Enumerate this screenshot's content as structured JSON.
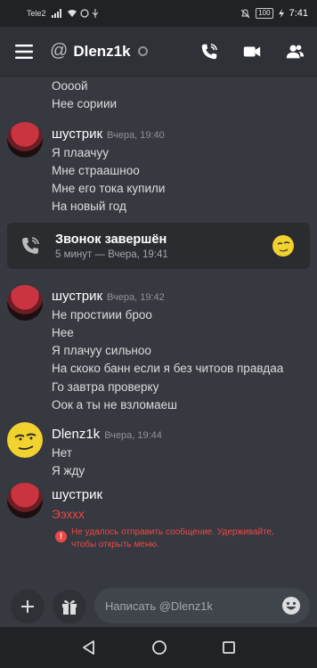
{
  "status_bar": {
    "carrier": "Tele2",
    "battery": "100",
    "time": "7:41"
  },
  "header": {
    "at_symbol": "@",
    "channel_name": "Dlenz1k"
  },
  "messages": {
    "top_lines": [
      "Оооой",
      "Нее сориии"
    ],
    "group1": {
      "author": "шустрик",
      "timestamp": "Вчера, 19:40",
      "lines": [
        "Я плаачуу",
        "Мне страашноо",
        "Мне его тока купили",
        "На новый год"
      ]
    },
    "call": {
      "title": "Звонок завершён",
      "subtitle": "5 минут — Вчера, 19:41"
    },
    "group2": {
      "author": "шустрик",
      "timestamp": "Вчера, 19:42",
      "lines": [
        "Не простиии броо",
        "Нее",
        "Я плачуу сильноо",
        "На скоко банн если я без читоов правдаа",
        "Го завтра проверку",
        "Оок а ты не взломаеш"
      ]
    },
    "group3": {
      "author": "Dlenz1k",
      "timestamp": "Вчера, 19:44",
      "lines": [
        "Нет",
        "Я жду"
      ]
    },
    "group4": {
      "author": "шустрик",
      "failed_line": "Ээххх",
      "error_lines": [
        "Не удалось отправить сообщение. Удерживайте,",
        "чтобы открыть меню."
      ]
    }
  },
  "composer": {
    "placeholder": "Написать @Dlenz1k"
  },
  "colors": {
    "background": "#36393f",
    "header": "#2f3136",
    "error": "#f04747",
    "avatar_yellow": "#f2d22e"
  }
}
